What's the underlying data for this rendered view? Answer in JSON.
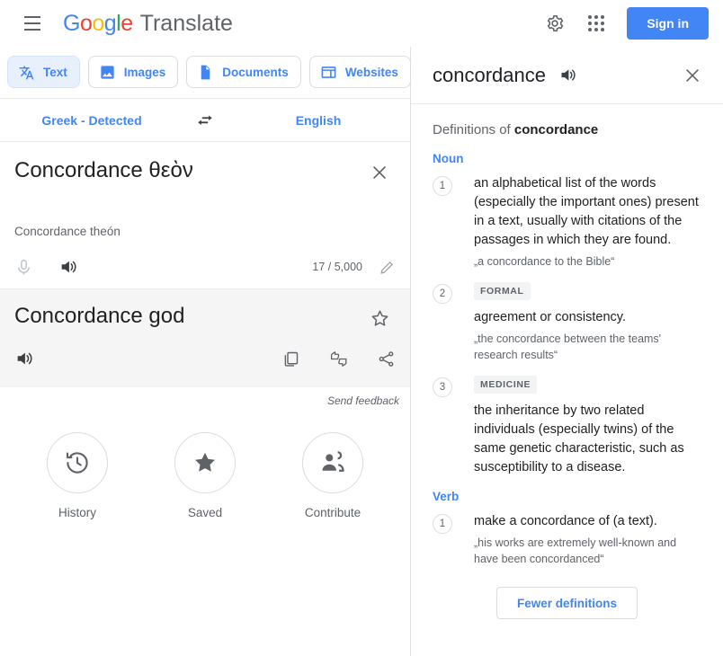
{
  "header": {
    "menu_label": "Main menu",
    "logo": "Google",
    "product": "Translate",
    "settings_label": "Settings",
    "apps_label": "Google apps",
    "signin_label": "Sign in"
  },
  "tabs": [
    {
      "label": "Text",
      "icon": "translate-icon",
      "active": true
    },
    {
      "label": "Images",
      "icon": "image-icon",
      "active": false
    },
    {
      "label": "Documents",
      "icon": "document-icon",
      "active": false
    },
    {
      "label": "Websites",
      "icon": "website-icon",
      "active": false
    }
  ],
  "languages": {
    "source": "Greek - Detected",
    "target": "English",
    "swap_label": "Swap languages"
  },
  "source": {
    "text": "Concordance θεὸν",
    "transliteration": "Concordance theón",
    "counter": "17 / 5,000",
    "mic_label": "Translate by voice",
    "listen_label": "Listen",
    "clear_label": "Clear source text",
    "handwrite_label": "Handwrite"
  },
  "output": {
    "text": "Concordance god",
    "save_label": "Save translation",
    "listen_label": "Listen",
    "copy_label": "Copy translation",
    "feedback_label": "Rate this translation",
    "share_label": "Share translation",
    "send_feedback": "Send feedback"
  },
  "quick_actions": [
    {
      "label": "History",
      "icon": "history-icon"
    },
    {
      "label": "Saved",
      "icon": "star-filled-icon"
    },
    {
      "label": "Contribute",
      "icon": "people-icon"
    }
  ],
  "definitions_panel": {
    "word": "concordance",
    "listen_label": "Listen",
    "close_label": "Close",
    "title_prefix": "Definitions of ",
    "title_word": "concordance",
    "sections": [
      {
        "pos": "Noun",
        "entries": [
          {
            "num": "1",
            "badge": "",
            "text": "an alphabetical list of the words (especially the important ones) present in a text, usually with citations of the passages in which they are found.",
            "example": "„a concordance to the Bible“"
          },
          {
            "num": "2",
            "badge": "FORMAL",
            "text": "agreement or consistency.",
            "example": "„the concordance between the teams' research results“"
          },
          {
            "num": "3",
            "badge": "MEDICINE",
            "text": "the inheritance by two related individuals (especially twins) of the same genetic characteristic, such as susceptibility to a disease.",
            "example": ""
          }
        ]
      },
      {
        "pos": "Verb",
        "entries": [
          {
            "num": "1",
            "badge": "",
            "text": "make a concordance of (a text).",
            "example": "„his works are extremely well-known and have been concordanced“"
          }
        ]
      }
    ],
    "fewer_label": "Fewer definitions"
  },
  "colors": {
    "brand_blue": "#4285F4",
    "brand_red": "#EA4335",
    "brand_yellow": "#FBBC05",
    "brand_green": "#34A853",
    "text_primary": "#202124",
    "text_secondary": "#5f6368",
    "output_bg": "#f5f5f5",
    "tab_active_bg": "#e8f0fe"
  }
}
